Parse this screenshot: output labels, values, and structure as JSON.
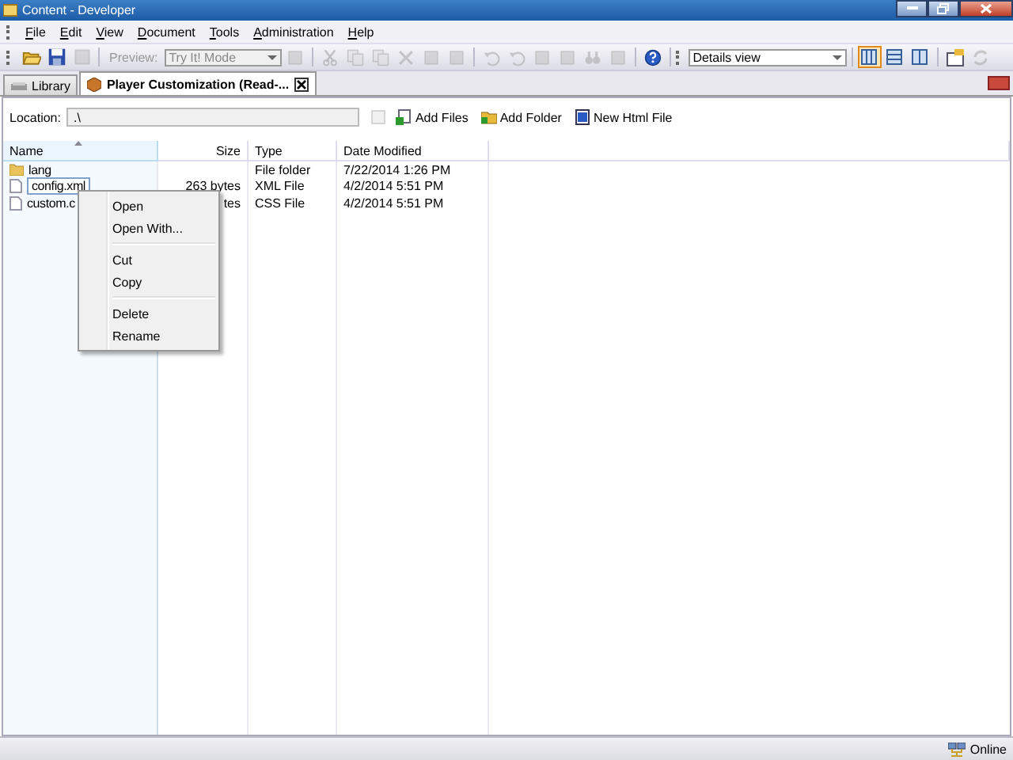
{
  "window": {
    "title": "Content - Developer"
  },
  "menu": [
    "File",
    "Edit",
    "View",
    "Document",
    "Tools",
    "Administration",
    "Help"
  ],
  "toolbar": {
    "tool_buttons": [
      {
        "disabled": false
      },
      {
        "disabled": false
      },
      {
        "disabled": true
      }
    ],
    "preview": {
      "label": "Preview:",
      "disabled": true
    },
    "mode": {
      "value": "Try It! Mode",
      "disabled": true
    },
    "edit_buttons": [
      {
        "disabled": true
      },
      {
        "disabled": true
      },
      {
        "disabled": true
      },
      {
        "disabled": true
      },
      {
        "disabled": true
      },
      {
        "disabled": true
      },
      {
        "disabled": true
      },
      {
        "disabled": true
      },
      {
        "disabled": true
      },
      {
        "disabled": true
      },
      {
        "disabled": true
      },
      {
        "disabled": true
      },
      {
        "disabled": true
      },
      {
        "disabled": false
      }
    ],
    "view": {
      "value": "Details view"
    },
    "view_buttons": [
      {
        "selected": true
      },
      {
        "selected": false
      },
      {
        "selected": false
      }
    ],
    "extra_buttons": [
      {
        "disabled": false
      },
      {
        "disabled": true
      }
    ]
  },
  "tabs": [
    {
      "label": "Library",
      "selected": false,
      "closable": false
    },
    {
      "label": "Player Customization (Read-...",
      "selected": true,
      "closable": true
    }
  ],
  "location": {
    "label": "Location:",
    "value": ".\\"
  },
  "actions": [
    {
      "label": "Add Files"
    },
    {
      "label": "Add Folder"
    },
    {
      "label": "New Html File"
    }
  ],
  "table": {
    "columns": [
      "Name",
      "Size",
      "Type",
      "Date Modified"
    ],
    "rows": [
      {
        "kind": "folder",
        "name": "lang",
        "size": "",
        "type": "File folder",
        "date": "7/22/2014 1:26 PM",
        "selected": false
      },
      {
        "kind": "file",
        "name": "config.xml",
        "size": "263 bytes",
        "type": "XML File",
        "date": "4/2/2014 5:51 PM",
        "selected": true
      },
      {
        "kind": "file",
        "name": "custom.c",
        "size": "tes",
        "type": "CSS File",
        "date": "4/2/2014 5:51 PM",
        "selected": false
      }
    ]
  },
  "context_menu": [
    [
      "Open",
      "Open With..."
    ],
    [
      "Cut",
      "Copy"
    ],
    [
      "Delete",
      "Rename"
    ]
  ],
  "status_bar": {
    "status": "Online"
  }
}
